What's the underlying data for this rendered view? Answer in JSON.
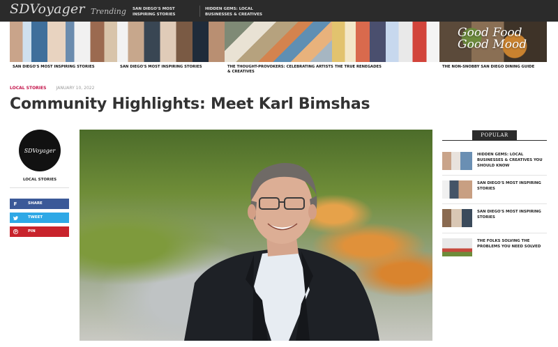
{
  "header": {
    "logo": "SDVoyager",
    "trending_label": "Trending",
    "trending_links": [
      "SAN DIEGO'S MOST INSPIRING STORIES",
      "HIDDEN GEMS: LOCAL BUSINESSES & CREATIVES"
    ]
  },
  "featured": [
    {
      "caption": "SAN DIEGO'S MOST INSPIRING STORIES"
    },
    {
      "caption": "SAN DIEGO'S MOST INSPIRING STORIES"
    },
    {
      "caption": "THE THOUGHT-PROVOKERS: CELEBRATING ARTISTS & CREATIVES"
    },
    {
      "caption": "THE TRUE RENEGADES"
    },
    {
      "caption": "THE NON-SNOBBY SAN DIEGO DINING GUIDE",
      "overlay_text": "Good Food Good Mood"
    }
  ],
  "article": {
    "category": "LOCAL STORIES",
    "date": "JANUARY 10, 2022",
    "title": "Community Highlights: Meet Karl Bimshas"
  },
  "author_box": {
    "avatar_text": "SDVoyager",
    "label": "LOCAL STORIES"
  },
  "share": {
    "facebook": "SHARE",
    "twitter": "TWEET",
    "pinterest": "PIN",
    "colors": {
      "facebook": "#3b5998",
      "twitter": "#2ea8e6",
      "pinterest": "#c8232c"
    }
  },
  "popular": {
    "heading": "POPULAR",
    "items": [
      {
        "title": "HIDDEN GEMS: LOCAL BUSINESSES & CREATIVES YOU SHOULD KNOW"
      },
      {
        "title": "SAN DIEGO'S MOST INSPIRING STORIES"
      },
      {
        "title": "SAN DIEGO'S MOST INSPIRING STORIES"
      },
      {
        "title": "THE FOLKS SOLVING THE PROBLEMS YOU NEED SOLVED"
      }
    ]
  },
  "colors": {
    "topbar": "#2b2b2b",
    "accent_category": "#c4144b"
  }
}
